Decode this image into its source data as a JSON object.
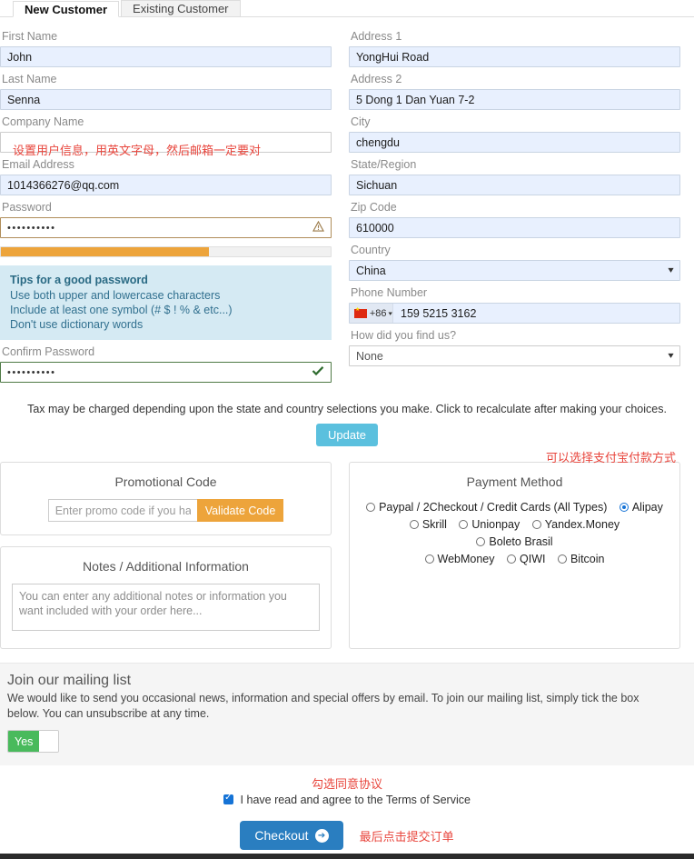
{
  "tabs": [
    {
      "label": "New Customer",
      "active": true
    },
    {
      "label": "Existing Customer",
      "active": false
    }
  ],
  "left_column": {
    "first_name": {
      "label": "First Name",
      "value": "John"
    },
    "last_name": {
      "label": "Last Name",
      "value": "Senna"
    },
    "company_name": {
      "label": "Company Name",
      "value": ""
    },
    "annotation_company": "设置用户信息，用英文字母，然后邮箱一定要对",
    "email": {
      "label": "Email Address",
      "value": "1014366276@qq.com"
    },
    "password": {
      "label": "Password",
      "value": "••••••••••",
      "icon": "warning-triangle-icon"
    },
    "strength": {
      "percent": 63,
      "color": "#eda43b"
    },
    "tips": {
      "title": "Tips for a good password",
      "lines": [
        "Use both upper and lowercase characters",
        "Include at least one symbol (# $ ! % & etc...)",
        "Don't use dictionary words"
      ]
    },
    "confirm_password": {
      "label": "Confirm Password",
      "value": "••••••••••",
      "icon": "check-icon"
    }
  },
  "right_column": {
    "address1": {
      "label": "Address 1",
      "value": "YongHui Road"
    },
    "address2": {
      "label": "Address 2",
      "value": "5 Dong 1 Dan Yuan 7-2"
    },
    "city": {
      "label": "City",
      "value": "chengdu"
    },
    "state": {
      "label": "State/Region",
      "value": "Sichuan"
    },
    "zip": {
      "label": "Zip Code",
      "value": "610000"
    },
    "country": {
      "label": "Country",
      "value": "China"
    },
    "phone": {
      "label": "Phone Number",
      "country_code": "+86",
      "value": "159 5215 3162"
    },
    "find_us": {
      "label": "How did you find us?",
      "value": "None"
    }
  },
  "tax": {
    "text": "Tax may be charged depending upon the state and country selections you make. Click to recalculate after making your choices.",
    "update_label": "Update"
  },
  "promo": {
    "title": "Promotional Code",
    "placeholder": "Enter promo code if you have one",
    "value": "",
    "button_label": "Validate Code"
  },
  "payment": {
    "title": "Payment Method",
    "annotation": "可以选择支付宝付款方式",
    "selected": "Alipay",
    "rows": [
      [
        {
          "label": "Paypal / 2Checkout / Credit Cards (All Types)",
          "selected": false
        },
        {
          "label": "Alipay",
          "selected": true
        }
      ],
      [
        {
          "label": "Skrill",
          "selected": false
        },
        {
          "label": "Unionpay",
          "selected": false
        },
        {
          "label": "Yandex.Money",
          "selected": false
        },
        {
          "label": "Boleto Brasil",
          "selected": false
        }
      ],
      [
        {
          "label": "WebMoney",
          "selected": false
        },
        {
          "label": "QIWI",
          "selected": false
        },
        {
          "label": "Bitcoin",
          "selected": false
        }
      ]
    ]
  },
  "notes": {
    "title": "Notes / Additional Information",
    "placeholder": "You can enter any additional notes or information you want included with your order here...",
    "value": ""
  },
  "mailing": {
    "title": "Join our mailing list",
    "body": "We would like to send you occasional news, information and special offers by email. To join our mailing list, simply tick the box below. You can unsubscribe at any time.",
    "toggle_label": "Yes",
    "toggle_on": true
  },
  "terms": {
    "annotation": "勾选同意协议",
    "label": "I have read and agree to the Terms of Service",
    "checked": true
  },
  "checkout": {
    "label": "Checkout",
    "annotation": "最后点击提交订单",
    "color": "#2a7ec0"
  }
}
